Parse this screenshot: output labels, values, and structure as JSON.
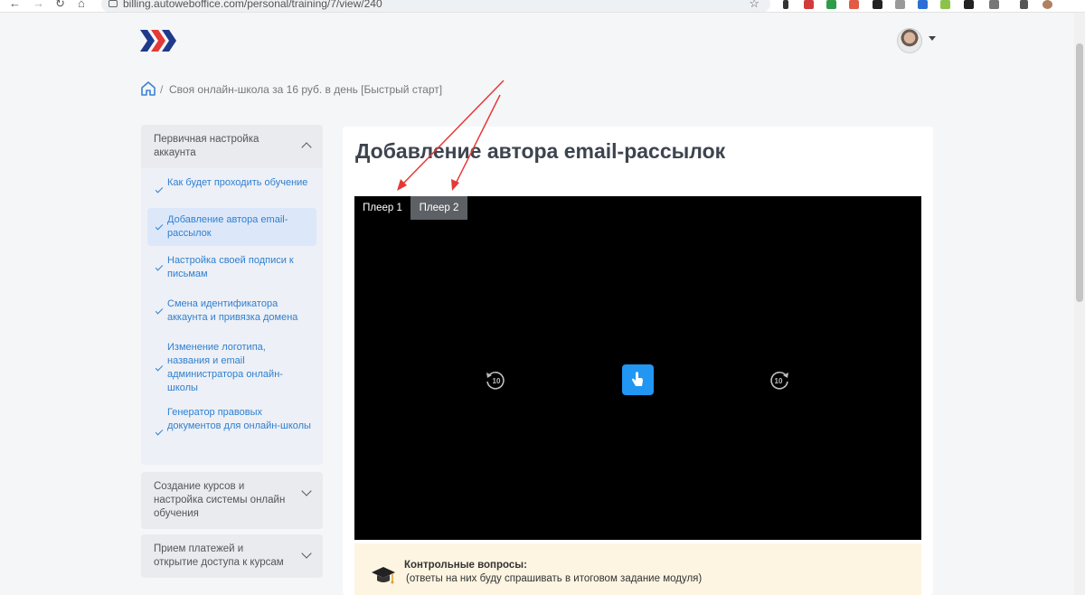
{
  "browser": {
    "url": "billing.autoweboffice.com/personal/training/7/view/240",
    "back": "←",
    "forward": "→",
    "reload": "↻",
    "home": "⌂",
    "bookmark": "☆"
  },
  "breadcrumb": {
    "separator": "/",
    "current": "Своя онлайн-школа за 16 руб. в день [Быстрый старт]"
  },
  "sidebar": {
    "sections": [
      {
        "title": "Первичная настройка аккаунта",
        "expanded": true,
        "items": [
          {
            "label": "Как будет проходить обучение",
            "active": false
          },
          {
            "label": "Добавление автора email-рассылок",
            "active": true
          },
          {
            "label": "Настройка своей подписи к письмам",
            "active": false
          },
          {
            "label": "Смена идентификатора аккаунта и привязка домена",
            "active": false
          },
          {
            "label": "Изменение логотипа, названия и email администратора онлайн-школы",
            "active": false
          },
          {
            "label": "Генератор правовых документов для онлайн-школы",
            "active": false
          }
        ]
      },
      {
        "title": "Создание курсов и настройка системы онлайн обучения",
        "expanded": false
      },
      {
        "title": "Прием платежей и открытие доступа к курсам",
        "expanded": false
      }
    ]
  },
  "main": {
    "title": "Добавление автора email-рассылок",
    "player_tabs": [
      "Плеер 1",
      "Плеер 2"
    ],
    "seek_back": "10",
    "seek_forward": "10",
    "quiz": {
      "title": "Контрольные вопросы:",
      "subtitle": "(ответы на них буду спрашивать в итоговом задание модуля)"
    }
  },
  "colors": {
    "accent": "#2f7fd0",
    "play_button": "#2196f3",
    "annotation_arrow": "#e53935",
    "quiz_bg": "#fdf5e2"
  }
}
